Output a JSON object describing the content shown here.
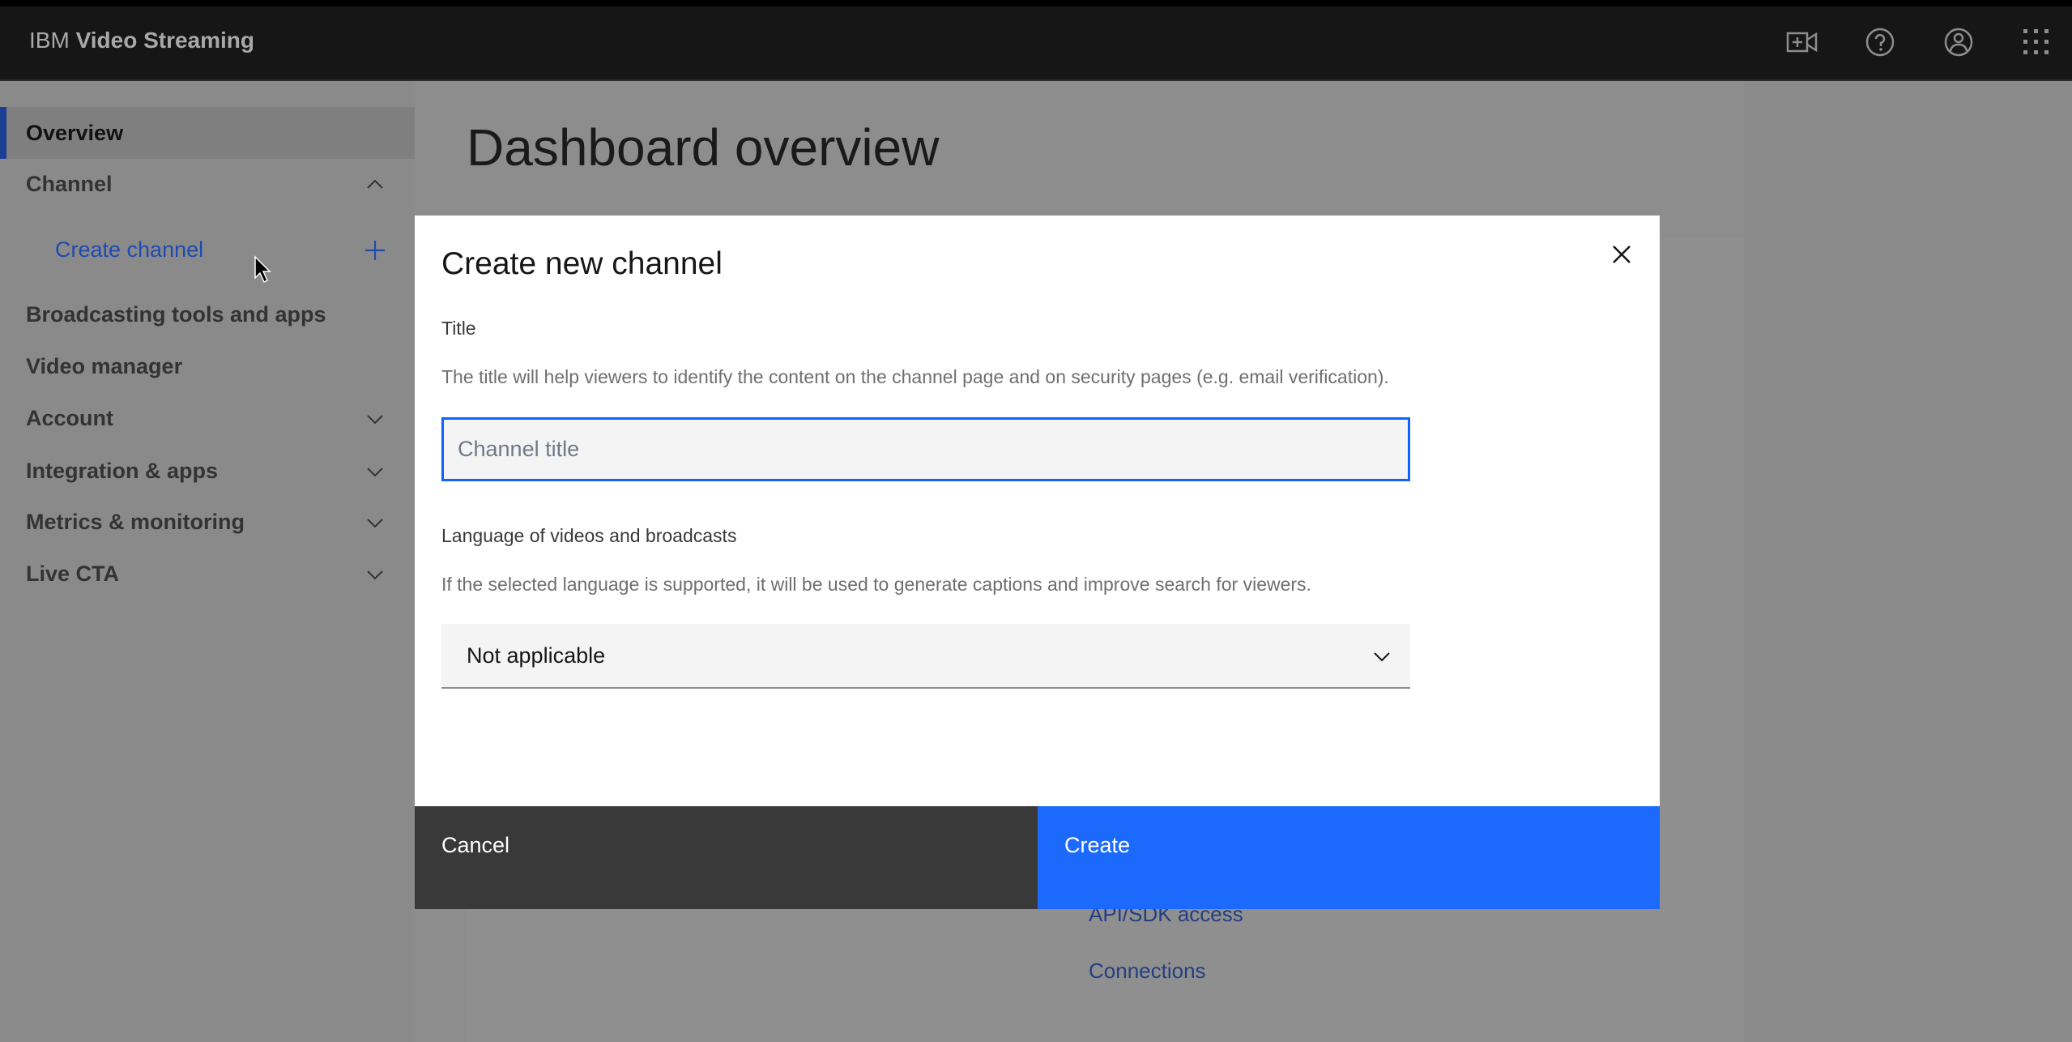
{
  "header": {
    "brand_prefix": "IBM",
    "brand_name": "Video Streaming",
    "icons": [
      "video-add-icon",
      "help-icon",
      "user-avatar-icon",
      "app-switcher-icon"
    ]
  },
  "sidebar": {
    "items": [
      {
        "label": "Overview",
        "active": true
      },
      {
        "label": "Channel",
        "chevron": "up"
      },
      {
        "label": "Create channel",
        "sub": true,
        "icon": "plus-icon"
      },
      {
        "label": "Broadcasting tools and apps"
      },
      {
        "label": "Video manager"
      },
      {
        "label": "Account",
        "chevron": "down"
      },
      {
        "label": "Integration & apps",
        "chevron": "down"
      },
      {
        "label": "Metrics & monitoring",
        "chevron": "down"
      },
      {
        "label": "Live CTA",
        "chevron": "down"
      }
    ]
  },
  "main": {
    "title": "Dashboard overview",
    "links": [
      "API/SDK access",
      "Connections"
    ]
  },
  "modal": {
    "title": "Create new channel",
    "title_label": "Title",
    "title_help": "The title will help viewers to identify the content on the channel page and on security pages (e.g. email verification).",
    "title_placeholder": "Channel title",
    "title_value": "",
    "language_label": "Language of videos and broadcasts",
    "language_help": "If the selected language is supported, it will be used to generate captions and improve search for viewers.",
    "language_value": "Not applicable",
    "cancel_label": "Cancel",
    "create_label": "Create"
  },
  "colors": {
    "accent": "#0f62fe",
    "create_button": "#1c69fd",
    "header": "#161616",
    "cancel_button": "#393939"
  }
}
